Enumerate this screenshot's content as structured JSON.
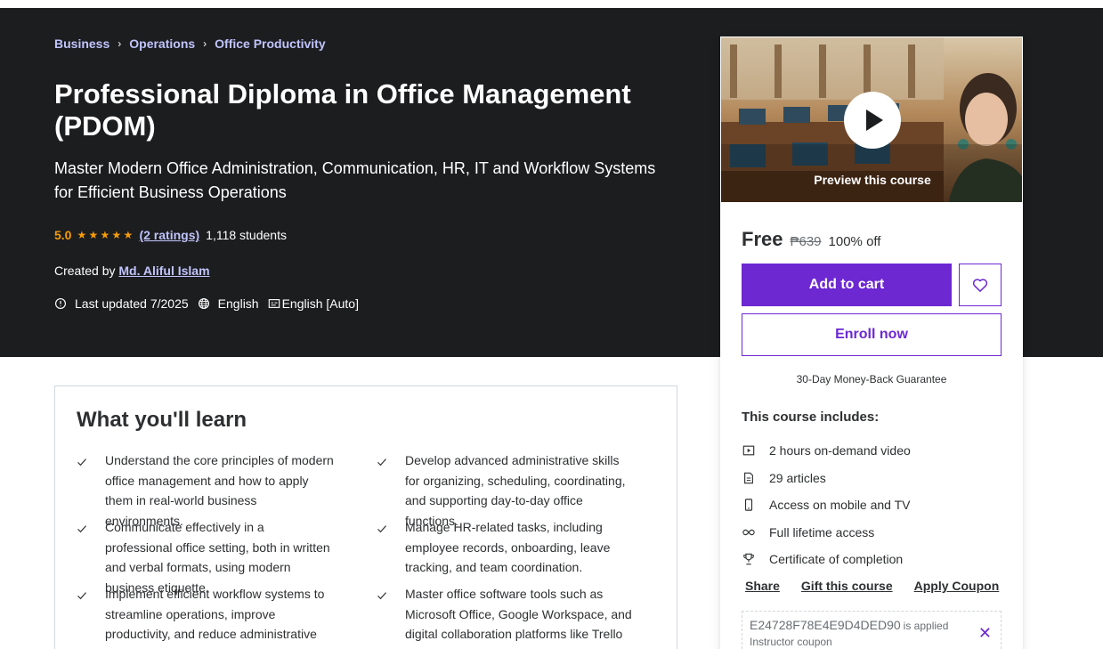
{
  "breadcrumb": [
    "Business",
    "Operations",
    "Office Productivity"
  ],
  "course": {
    "title": "Professional Diploma in Office Management (PDOM)",
    "subtitle": "Master Modern Office Administration, Communication, HR, IT and Workflow Systems for Efficient Business Operations",
    "rating": "5.0",
    "rating_stars": 5,
    "ratings_count": "(2 ratings)",
    "students": "1,118 students",
    "created_by_label": "Created by",
    "instructor": "Md. Aliful Islam",
    "last_updated": "Last updated 7/2025",
    "language": "English",
    "captions": "English [Auto]"
  },
  "card": {
    "preview_label": "Preview this course",
    "price": "Free",
    "original_price": "₱639",
    "discount": "100% off",
    "add_to_cart": "Add to cart",
    "enroll_now": "Enroll now",
    "guarantee": "30-Day Money-Back Guarantee",
    "includes_title": "This course includes:",
    "includes": [
      {
        "icon": "video-icon",
        "text": "2 hours on-demand video"
      },
      {
        "icon": "article-icon",
        "text": "29 articles"
      },
      {
        "icon": "mobile-icon",
        "text": "Access on mobile and TV"
      },
      {
        "icon": "infinity-icon",
        "text": "Full lifetime access"
      },
      {
        "icon": "trophy-icon",
        "text": "Certificate of completion"
      }
    ],
    "actions": [
      "Share",
      "Gift this course",
      "Apply Coupon"
    ],
    "coupon_code": "E24728F78E4E9D4DED90",
    "coupon_applied": "is applied",
    "coupon_type": "Instructor coupon"
  },
  "learn": {
    "title": "What you'll learn",
    "items": [
      "Understand the core principles of modern office management and how to apply them in real-world business environments.",
      "Develop advanced administrative skills for organizing, scheduling, coordinating, and supporting day-to-day office functions.",
      "Communicate effectively in a professional office setting, both in written and verbal formats, using modern business etiquette.",
      "Manage HR-related tasks, including employee records, onboarding, leave tracking, and team coordination.",
      "Implement efficient workflow systems to streamline operations, improve productivity, and reduce administrative bottlenecks.",
      "Master office software tools such as Microsoft Office, Google Workspace, and digital collaboration platforms like Trello and Zoom."
    ]
  },
  "colors": {
    "hero_bg": "#1c1d1f",
    "accent": "#6d28d2",
    "link": "#c0c4fc",
    "star": "#f69c08"
  }
}
